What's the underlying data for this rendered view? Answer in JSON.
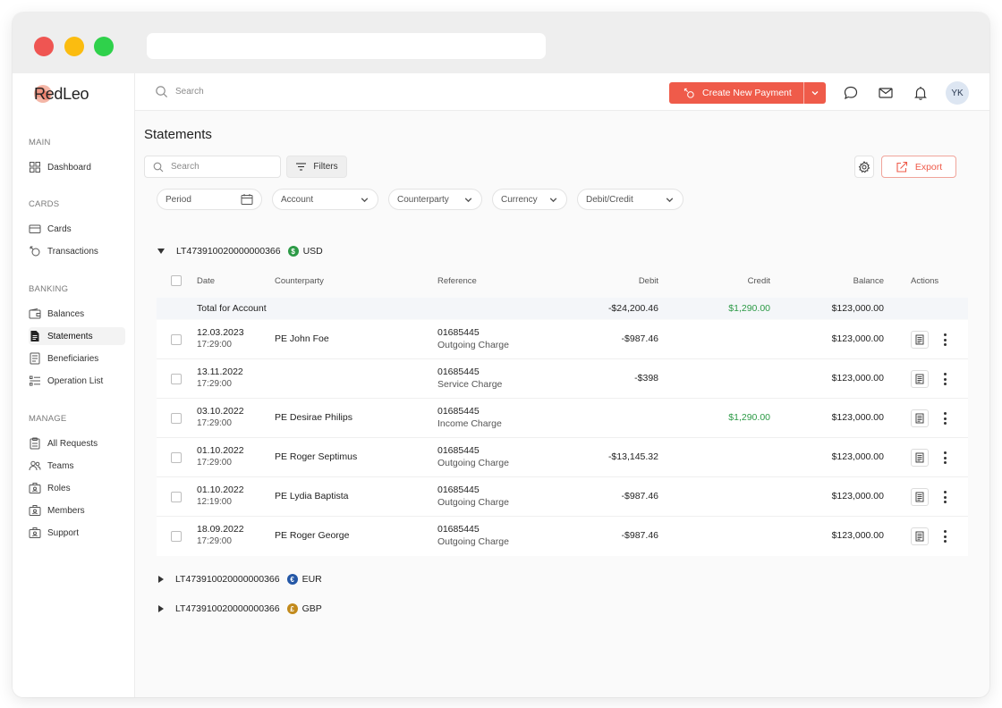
{
  "brand": {
    "name": "RedLeo"
  },
  "colors": {
    "accent": "#ef5b4a",
    "credit_green": "#2c9a46",
    "usd_badge": "#2c9a46",
    "eur_badge": "#2457a6",
    "gbp_badge": "#c28a1c"
  },
  "sidebar": {
    "sections": [
      {
        "title": "MAIN",
        "items": [
          {
            "label": "Dashboard",
            "icon": "dashboard-icon"
          }
        ]
      },
      {
        "title": "CARDS",
        "items": [
          {
            "label": "Cards",
            "icon": "card-icon"
          },
          {
            "label": "Transactions",
            "icon": "transactions-icon"
          }
        ]
      },
      {
        "title": "BANKING",
        "items": [
          {
            "label": "Balances",
            "icon": "wallet-icon"
          },
          {
            "label": "Statements",
            "icon": "statement-icon",
            "active": true
          },
          {
            "label": "Beneficiaries",
            "icon": "beneficiaries-icon"
          },
          {
            "label": "Operation List",
            "icon": "list-icon"
          }
        ]
      },
      {
        "title": "MANAGE",
        "items": [
          {
            "label": "All Requests",
            "icon": "requests-icon"
          },
          {
            "label": "Teams",
            "icon": "teams-icon"
          },
          {
            "label": "Roles",
            "icon": "roles-icon"
          },
          {
            "label": "Members",
            "icon": "members-icon"
          },
          {
            "label": "Support",
            "icon": "support-icon"
          }
        ]
      }
    ]
  },
  "topbar": {
    "search_placeholder": "Search",
    "create_payment_label": "Create New Payment",
    "avatar_initials": "YK"
  },
  "page": {
    "title": "Statements",
    "search_placeholder": "Search",
    "filters_label": "Filters",
    "export_label": "Export",
    "filter_pills": [
      {
        "label": "Period"
      },
      {
        "label": "Account"
      },
      {
        "label": "Counterparty"
      },
      {
        "label": "Currency"
      },
      {
        "label": "Debit/Credit"
      }
    ]
  },
  "accounts": [
    {
      "number": "LT473910020000000366",
      "currency": "USD",
      "symbol": "$",
      "expanded": true
    },
    {
      "number": "LT473910020000000366",
      "currency": "EUR",
      "symbol": "€",
      "expanded": false
    },
    {
      "number": "LT473910020000000366",
      "currency": "GBP",
      "symbol": "£",
      "expanded": false
    }
  ],
  "table": {
    "headers": {
      "date": "Date",
      "counterparty": "Counterparty",
      "reference": "Reference",
      "debit": "Debit",
      "credit": "Credit",
      "balance": "Balance",
      "actions": "Actions"
    },
    "total": {
      "label": "Total for Account",
      "debit": "-$24,200.46",
      "credit": "$1,290.00",
      "balance": "$123,000.00"
    },
    "rows": [
      {
        "date": "12.03.2023",
        "time": "17:29:00",
        "counterparty": "PE John Foe",
        "ref_no": "01685445",
        "ref_type": "Outgoing Charge",
        "debit": "-$987.46",
        "credit": "",
        "balance": "$123,000.00"
      },
      {
        "date": "13.11.2022",
        "time": "17:29:00",
        "counterparty": "",
        "ref_no": "01685445",
        "ref_type": "Service Charge",
        "debit": "-$398",
        "credit": "",
        "balance": "$123,000.00"
      },
      {
        "date": "03.10.2022",
        "time": "17:29:00",
        "counterparty": "PE Desirae Philips",
        "ref_no": "01685445",
        "ref_type": "Income Charge",
        "debit": "",
        "credit": "$1,290.00",
        "balance": "$123,000.00"
      },
      {
        "date": "01.10.2022",
        "time": "17:29:00",
        "counterparty": "PE Roger Septimus",
        "ref_no": "01685445",
        "ref_type": "Outgoing Charge",
        "debit": "-$13,145.32",
        "credit": "",
        "balance": "$123,000.00"
      },
      {
        "date": "01.10.2022",
        "time": "12:19:00",
        "counterparty": "PE Lydia Baptista",
        "ref_no": "01685445",
        "ref_type": "Outgoing Charge",
        "debit": "-$987.46",
        "credit": "",
        "balance": "$123,000.00"
      },
      {
        "date": "18.09.2022",
        "time": "17:29:00",
        "counterparty": "PE Roger George",
        "ref_no": "01685445",
        "ref_type": "Outgoing Charge",
        "debit": "-$987.46",
        "credit": "",
        "balance": "$123,000.00"
      }
    ]
  }
}
